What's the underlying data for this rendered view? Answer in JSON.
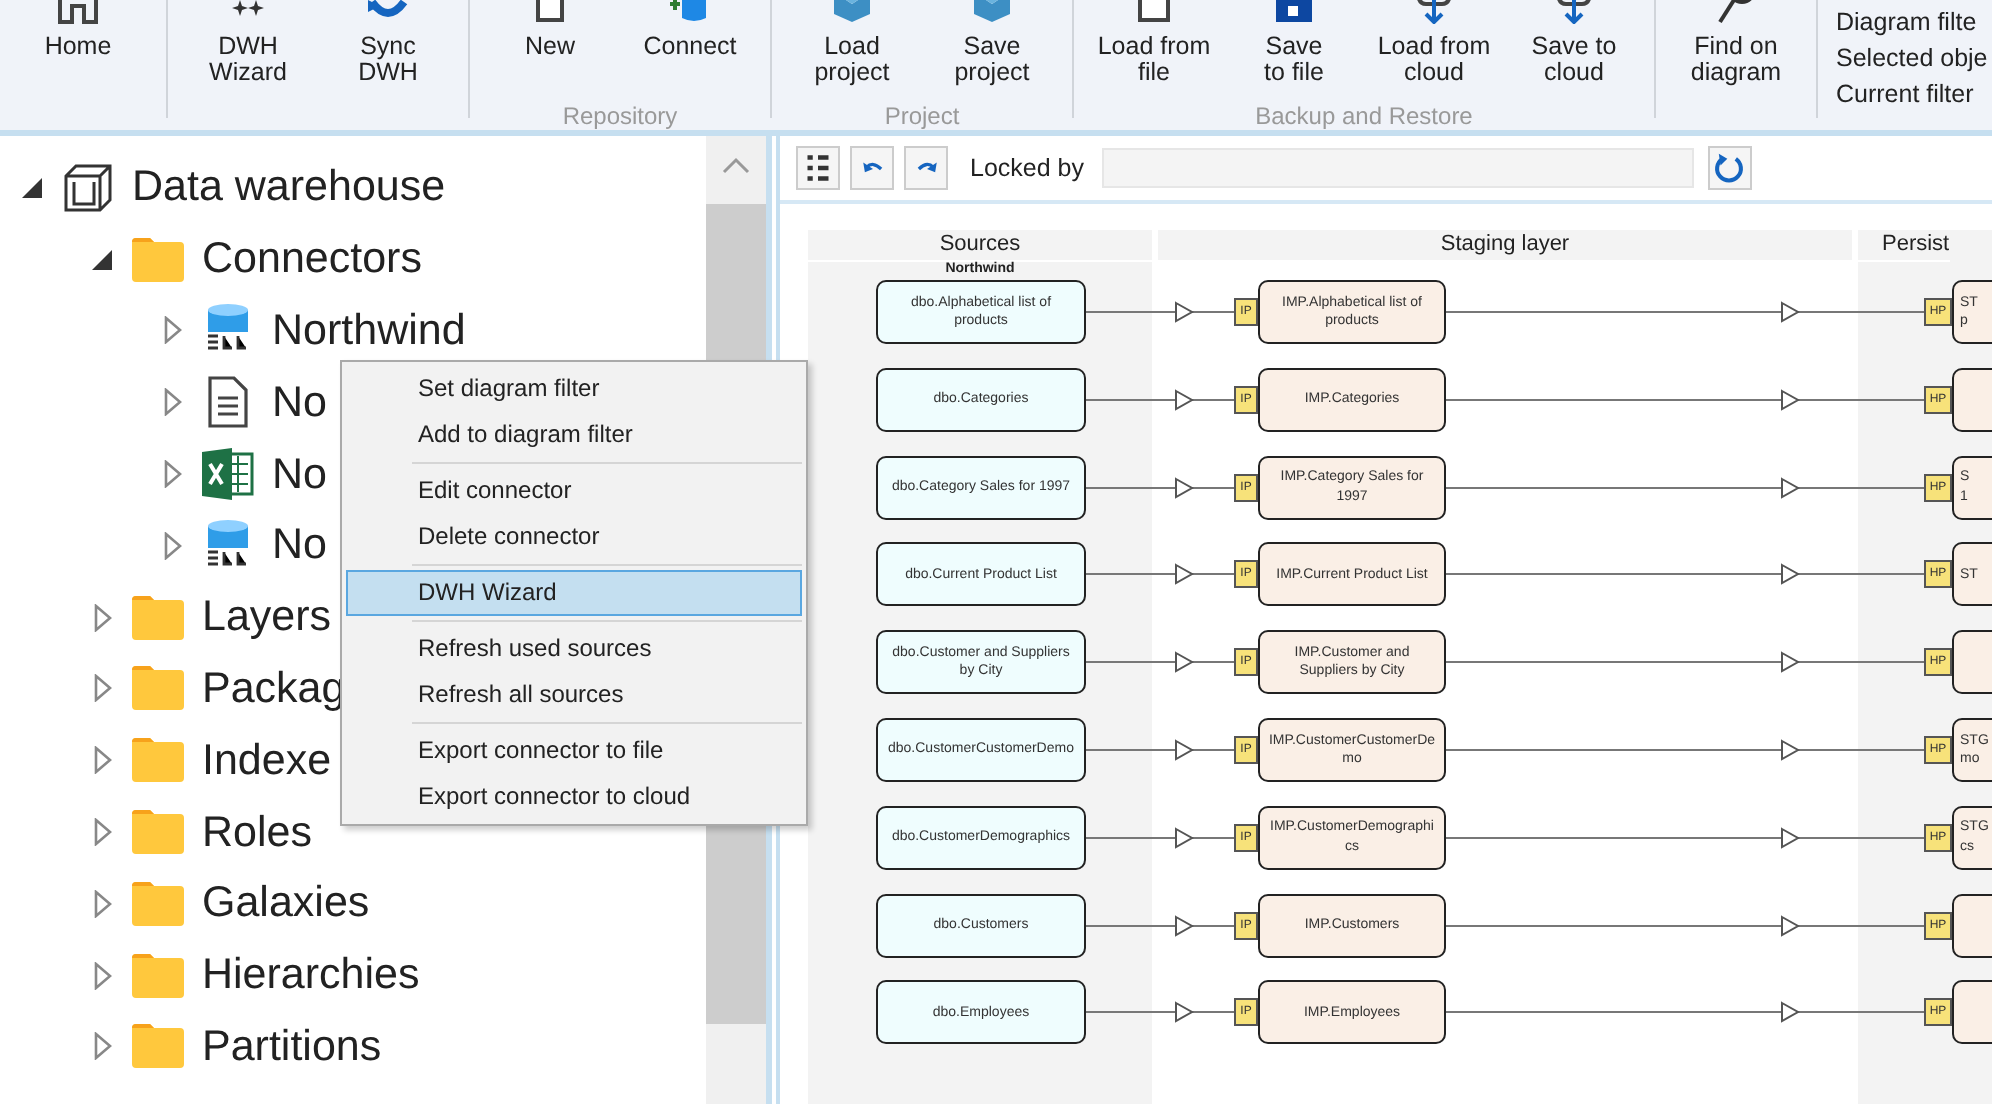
{
  "ribbon": {
    "groups": [
      {
        "buttons": [
          {
            "label": "Home",
            "kind": "home"
          }
        ]
      },
      {
        "buttons": [
          {
            "label": "DWH\nWizard",
            "kind": "wizard"
          },
          {
            "label": "Sync\nDWH",
            "kind": "sync"
          }
        ]
      },
      {
        "label": "Repository",
        "buttons": [
          {
            "label": "New",
            "kind": "new"
          },
          {
            "label": "Connect",
            "kind": "connect"
          }
        ]
      },
      {
        "label": "Project",
        "buttons": [
          {
            "label": "Load\nproject",
            "kind": "project"
          },
          {
            "label": "Save\nproject",
            "kind": "project"
          }
        ]
      },
      {
        "label": "Backup and Restore",
        "buttons": [
          {
            "label": "Load from\nfile",
            "kind": "file"
          },
          {
            "label": "Save\nto file",
            "kind": "disk"
          },
          {
            "label": "Load from\ncloud",
            "kind": "cloud"
          },
          {
            "label": "Save to\ncloud",
            "kind": "cloud"
          }
        ]
      },
      {
        "buttons": [
          {
            "label": "Find on\ndiagram",
            "kind": "find"
          }
        ]
      }
    ],
    "filter_links": [
      "Diagram filte",
      "Selected obje",
      "Current filter"
    ]
  },
  "tree": [
    {
      "label": "Data warehouse",
      "kind": "warehouse",
      "expanded": true,
      "children": [
        {
          "label": "Connectors",
          "kind": "folder",
          "expanded": true,
          "children": [
            {
              "label": "Northwind",
              "kind": "sql",
              "expanded": false
            },
            {
              "label": "No",
              "kind": "text",
              "expanded": false
            },
            {
              "label": "No",
              "kind": "excel",
              "expanded": false
            },
            {
              "label": "No",
              "kind": "sql",
              "expanded": false
            }
          ]
        },
        {
          "label": "Layers",
          "kind": "folder",
          "expanded": false
        },
        {
          "label": "Packag",
          "kind": "folder",
          "expanded": false
        },
        {
          "label": "Indexe",
          "kind": "folder",
          "expanded": false
        },
        {
          "label": "Roles",
          "kind": "folder",
          "expanded": false
        },
        {
          "label": "Galaxies",
          "kind": "folder",
          "expanded": false
        },
        {
          "label": "Hierarchies",
          "kind": "folder",
          "expanded": false
        },
        {
          "label": "Partitions",
          "kind": "folder",
          "expanded": false
        }
      ]
    }
  ],
  "context_menu": {
    "groups": [
      [
        {
          "label": "Set diagram filter",
          "selected": false
        },
        {
          "label": "Add to diagram filter",
          "selected": false
        }
      ],
      [
        {
          "label": "Edit connector",
          "selected": false
        },
        {
          "label": "Delete connector",
          "selected": false
        }
      ],
      [
        {
          "label": "DWH Wizard",
          "selected": true
        }
      ],
      [
        {
          "label": "Refresh used sources",
          "selected": false
        },
        {
          "label": "Refresh all sources",
          "selected": false
        }
      ],
      [
        {
          "label": "Export connector to file",
          "selected": false
        },
        {
          "label": "Export connector to cloud",
          "selected": false
        }
      ]
    ]
  },
  "diagram_toolbar": {
    "locked_by_label": "Locked by"
  },
  "diagram": {
    "columns": [
      "Sources",
      "Staging layer",
      "Persist"
    ],
    "source_group": "Northwind",
    "rows": [
      {
        "source": "dbo.Alphabetical list of products",
        "import_badge": "IP",
        "staging": "IMP.Alphabetical list of products",
        "persist_badge": "HP",
        "persist": [
          "ST",
          "p"
        ]
      },
      {
        "source": "dbo.Categories",
        "import_badge": "IP",
        "staging": "IMP.Categories",
        "persist_badge": "HP"
      },
      {
        "source": "dbo.Category Sales for 1997",
        "import_badge": "IP",
        "staging": "IMP.Category Sales for 1997",
        "persist_badge": "HP",
        "persist": [
          "S",
          "1"
        ]
      },
      {
        "source": "dbo.Current Product List",
        "import_badge": "IP",
        "staging": "IMP.Current Product List",
        "persist_badge": "HP",
        "persist": [
          "ST"
        ]
      },
      {
        "source": "dbo.Customer and Suppliers by City",
        "import_badge": "IP",
        "staging": "IMP.Customer and Suppliers by City",
        "persist_badge": "HP"
      },
      {
        "source": "dbo.CustomerCustomerDemo",
        "import_badge": "IP",
        "staging": "IMP.CustomerCustomerDemo",
        "persist_badge": "HP",
        "persist": [
          "STG",
          "mo"
        ]
      },
      {
        "source": "dbo.CustomerDemographics",
        "import_badge": "IP",
        "staging": "IMP.CustomerDemographics",
        "persist_badge": "HP",
        "persist": [
          "STG",
          "cs"
        ]
      },
      {
        "source": "dbo.Customers",
        "import_badge": "IP",
        "staging": "IMP.Customers",
        "persist_badge": "HP"
      },
      {
        "source": "dbo.Employees",
        "import_badge": "IP",
        "staging": "IMP.Employees",
        "persist_badge": "HP"
      }
    ]
  }
}
